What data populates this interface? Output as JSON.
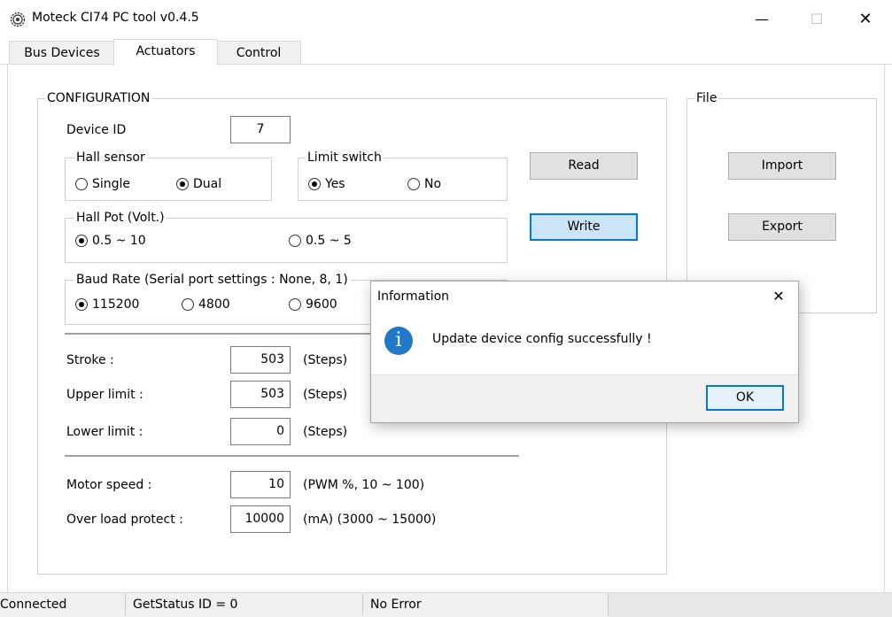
{
  "window": {
    "title": "Moteck CI74 PC tool v0.4.5",
    "minimize": "—",
    "maximize": "☐",
    "close": "✕"
  },
  "tabs": [
    {
      "label": "Bus Devices"
    },
    {
      "label": "Actuators",
      "active": true
    },
    {
      "label": "Control"
    }
  ],
  "config": {
    "title": "CONFIGURATION",
    "device_id_label": "Device ID",
    "device_id_value": "7",
    "hall_sensor": {
      "title": "Hall sensor",
      "options": [
        "Single",
        "Dual"
      ],
      "selected": "Dual"
    },
    "limit_switch": {
      "title": "Limit switch",
      "options": [
        "Yes",
        "No"
      ],
      "selected": "Yes"
    },
    "hall_pot": {
      "title": "Hall Pot (Volt.)",
      "options": [
        "0.5 ~ 10",
        "0.5 ~ 5"
      ],
      "selected": "0.5 ~ 10"
    },
    "baud": {
      "title": "Baud Rate (Serial port settings : None, 8, 1)",
      "options": [
        "115200",
        "4800",
        "9600"
      ],
      "selected": "115200"
    },
    "stroke": {
      "label": "Stroke :",
      "value": "503",
      "unit": "(Steps)"
    },
    "upper_limit": {
      "label": "Upper limit :",
      "value": "503",
      "unit": "(Steps)"
    },
    "lower_limit": {
      "label": "Lower limit :",
      "value": "0",
      "unit": "(Steps)"
    },
    "motor_speed": {
      "label": "Motor speed :",
      "value": "10",
      "unit": "(PWM %, 10 ~ 100)"
    },
    "over_load": {
      "label": "Over load protect :",
      "value": "10000",
      "unit": "(mA) (3000 ~ 15000)"
    },
    "read_label": "Read",
    "write_label": "Write"
  },
  "file": {
    "title": "File",
    "import_label": "Import",
    "export_label": "Export"
  },
  "dialog": {
    "title": "Information",
    "close": "✕",
    "icon": "i",
    "message": "Update device config successfully !",
    "ok_label": "OK"
  },
  "status": {
    "connection": "Connected",
    "get_status": "GetStatus ID = 0",
    "error": "No Error"
  }
}
